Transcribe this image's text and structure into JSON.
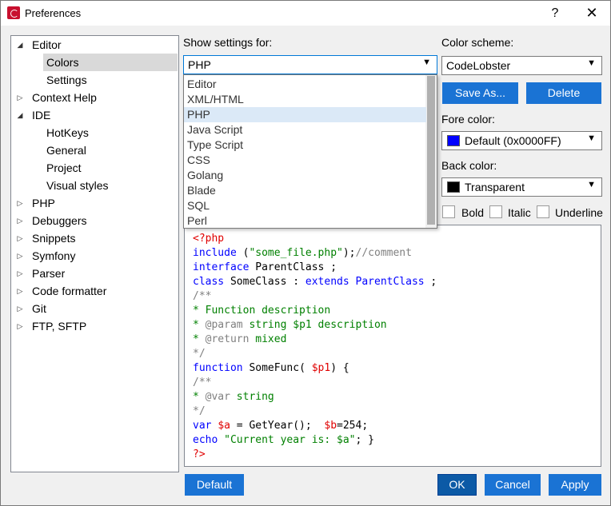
{
  "window": {
    "title": "Preferences",
    "help_label": "?",
    "close_label": "✕"
  },
  "tree": {
    "items": [
      {
        "label": "Editor",
        "arrow": "◢"
      },
      {
        "label": "Colors"
      },
      {
        "label": "Settings"
      },
      {
        "label": "Context Help",
        "arrow": "▷"
      },
      {
        "label": "IDE",
        "arrow": "◢"
      },
      {
        "label": "HotKeys"
      },
      {
        "label": "General"
      },
      {
        "label": "Project"
      },
      {
        "label": "Visual styles"
      },
      {
        "label": "PHP",
        "arrow": "▷"
      },
      {
        "label": "Debuggers",
        "arrow": "▷"
      },
      {
        "label": "Snippets",
        "arrow": "▷"
      },
      {
        "label": "Symfony",
        "arrow": "▷"
      },
      {
        "label": "Parser",
        "arrow": "▷"
      },
      {
        "label": "Code formatter",
        "arrow": "▷"
      },
      {
        "label": "Git",
        "arrow": "▷"
      },
      {
        "label": "FTP, SFTP",
        "arrow": "▷"
      }
    ]
  },
  "settings": {
    "show_settings_for_label": "Show settings for:",
    "show_settings_value": "PHP",
    "color_scheme_label": "Color scheme:",
    "color_scheme_value": "CodeLobster",
    "save_as_label": "Save As...",
    "delete_label": "Delete",
    "fore_color_label": "Fore color:",
    "fore_color_value": "Default (0x0000FF)",
    "fore_color_swatch": "#0000ff",
    "back_color_label": "Back color:",
    "back_color_value": "Transparent",
    "back_color_swatch": "#000000",
    "bold_label": "Bold",
    "italic_label": "Italic",
    "underline_label": "Underline",
    "dropdown_arrow": "▼"
  },
  "dropdown": {
    "options": [
      "Editor",
      "XML/HTML",
      "PHP",
      "Java Script",
      "Type Script",
      "CSS",
      "Golang",
      "Blade",
      "SQL",
      "Perl"
    ],
    "selected_index": 2
  },
  "code": {
    "lines": [
      [
        {
          "t": "<?php",
          "c": "red"
        }
      ],
      [
        {
          "t": "include",
          "c": "blue"
        },
        {
          "t": " (",
          "c": "black"
        },
        {
          "t": "\"some_file.php\"",
          "c": "green"
        },
        {
          "t": ");",
          "c": "black"
        },
        {
          "t": "//comment",
          "c": "gray"
        }
      ],
      [
        {
          "t": "interface",
          "c": "blue"
        },
        {
          "t": " ParentClass ;",
          "c": "black"
        }
      ],
      [
        {
          "t": "class",
          "c": "blue"
        },
        {
          "t": " SomeClass : ",
          "c": "black"
        },
        {
          "t": "extends",
          "c": "blue"
        },
        {
          "t": " ",
          "c": "black"
        },
        {
          "t": "ParentClass",
          "c": "blue"
        },
        {
          "t": " ;",
          "c": "black"
        }
      ],
      [
        {
          "t": "/**",
          "c": "gray"
        }
      ],
      [
        {
          "t": "* Function description",
          "c": "green"
        }
      ],
      [
        {
          "t": "* ",
          "c": "green"
        },
        {
          "t": "@param",
          "c": "gray"
        },
        {
          "t": " string $p1 description",
          "c": "green"
        }
      ],
      [
        {
          "t": "* ",
          "c": "green"
        },
        {
          "t": "@return",
          "c": "gray"
        },
        {
          "t": " mixed",
          "c": "green"
        }
      ],
      [
        {
          "t": "*/",
          "c": "gray"
        }
      ],
      [
        {
          "t": "function",
          "c": "blue"
        },
        {
          "t": " SomeFunc( ",
          "c": "black"
        },
        {
          "t": "$p1",
          "c": "red"
        },
        {
          "t": ") {",
          "c": "black"
        }
      ],
      [
        {
          "t": "/**",
          "c": "gray"
        }
      ],
      [
        {
          "t": "* ",
          "c": "green"
        },
        {
          "t": "@var",
          "c": "gray"
        },
        {
          "t": " string",
          "c": "green"
        }
      ],
      [
        {
          "t": "*/",
          "c": "gray"
        }
      ],
      [
        {
          "t": "var",
          "c": "blue"
        },
        {
          "t": " ",
          "c": "black"
        },
        {
          "t": "$a",
          "c": "red"
        },
        {
          "t": " = GetYear();  ",
          "c": "black"
        },
        {
          "t": "$b",
          "c": "red"
        },
        {
          "t": "=254;",
          "c": "black"
        }
      ],
      [
        {
          "t": "echo",
          "c": "blue"
        },
        {
          "t": " ",
          "c": "black"
        },
        {
          "t": "\"Current year is: $a\"",
          "c": "green"
        },
        {
          "t": "; }",
          "c": "black"
        }
      ],
      [
        {
          "t": "?>",
          "c": "red"
        }
      ]
    ]
  },
  "footer": {
    "default_label": "Default",
    "ok_label": "OK",
    "cancel_label": "Cancel",
    "apply_label": "Apply"
  }
}
